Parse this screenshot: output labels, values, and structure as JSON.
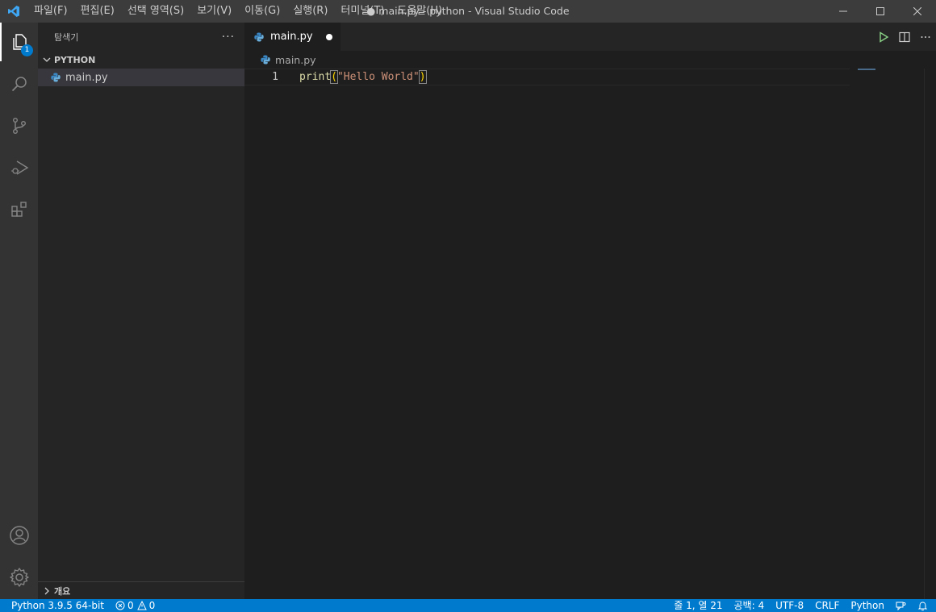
{
  "titlebar": {
    "menus": [
      "파일(F)",
      "편집(E)",
      "선택 영역(S)",
      "보기(V)",
      "이동(G)",
      "실행(R)",
      "터미널(T)",
      "도움말(H)"
    ],
    "window_title": "● main.py - python - Visual Studio Code",
    "logo_icon": "vscode-logo-icon"
  },
  "activitybar": {
    "explorer_badge": "1",
    "items": [
      "explorer-icon",
      "search-icon",
      "source-control-icon",
      "run-debug-icon",
      "extensions-icon",
      "account-icon",
      "settings-gear-icon"
    ]
  },
  "sidebar": {
    "title": "탐색기",
    "more": "···",
    "section": "PYTHON",
    "file": "main.py",
    "outline": "개요"
  },
  "editor": {
    "tab_label": "main.py",
    "breadcrumb": "main.py",
    "line_number": "1",
    "code": {
      "fn": "print",
      "open_paren": "(",
      "string": "\"Hello World\"",
      "close_paren": ")"
    }
  },
  "statusbar": {
    "interpreter": "Python 3.9.5 64-bit",
    "errors": "0",
    "warnings": "0",
    "position": "줄 1, 열 21",
    "indent": "공백: 4",
    "encoding": "UTF-8",
    "eol": "CRLF",
    "language": "Python"
  },
  "colors": {
    "accent": "#007acc",
    "titlebar": "#3c3c3c",
    "activitybar": "#333333",
    "sidebar": "#252526",
    "editor": "#1e1e1e"
  }
}
